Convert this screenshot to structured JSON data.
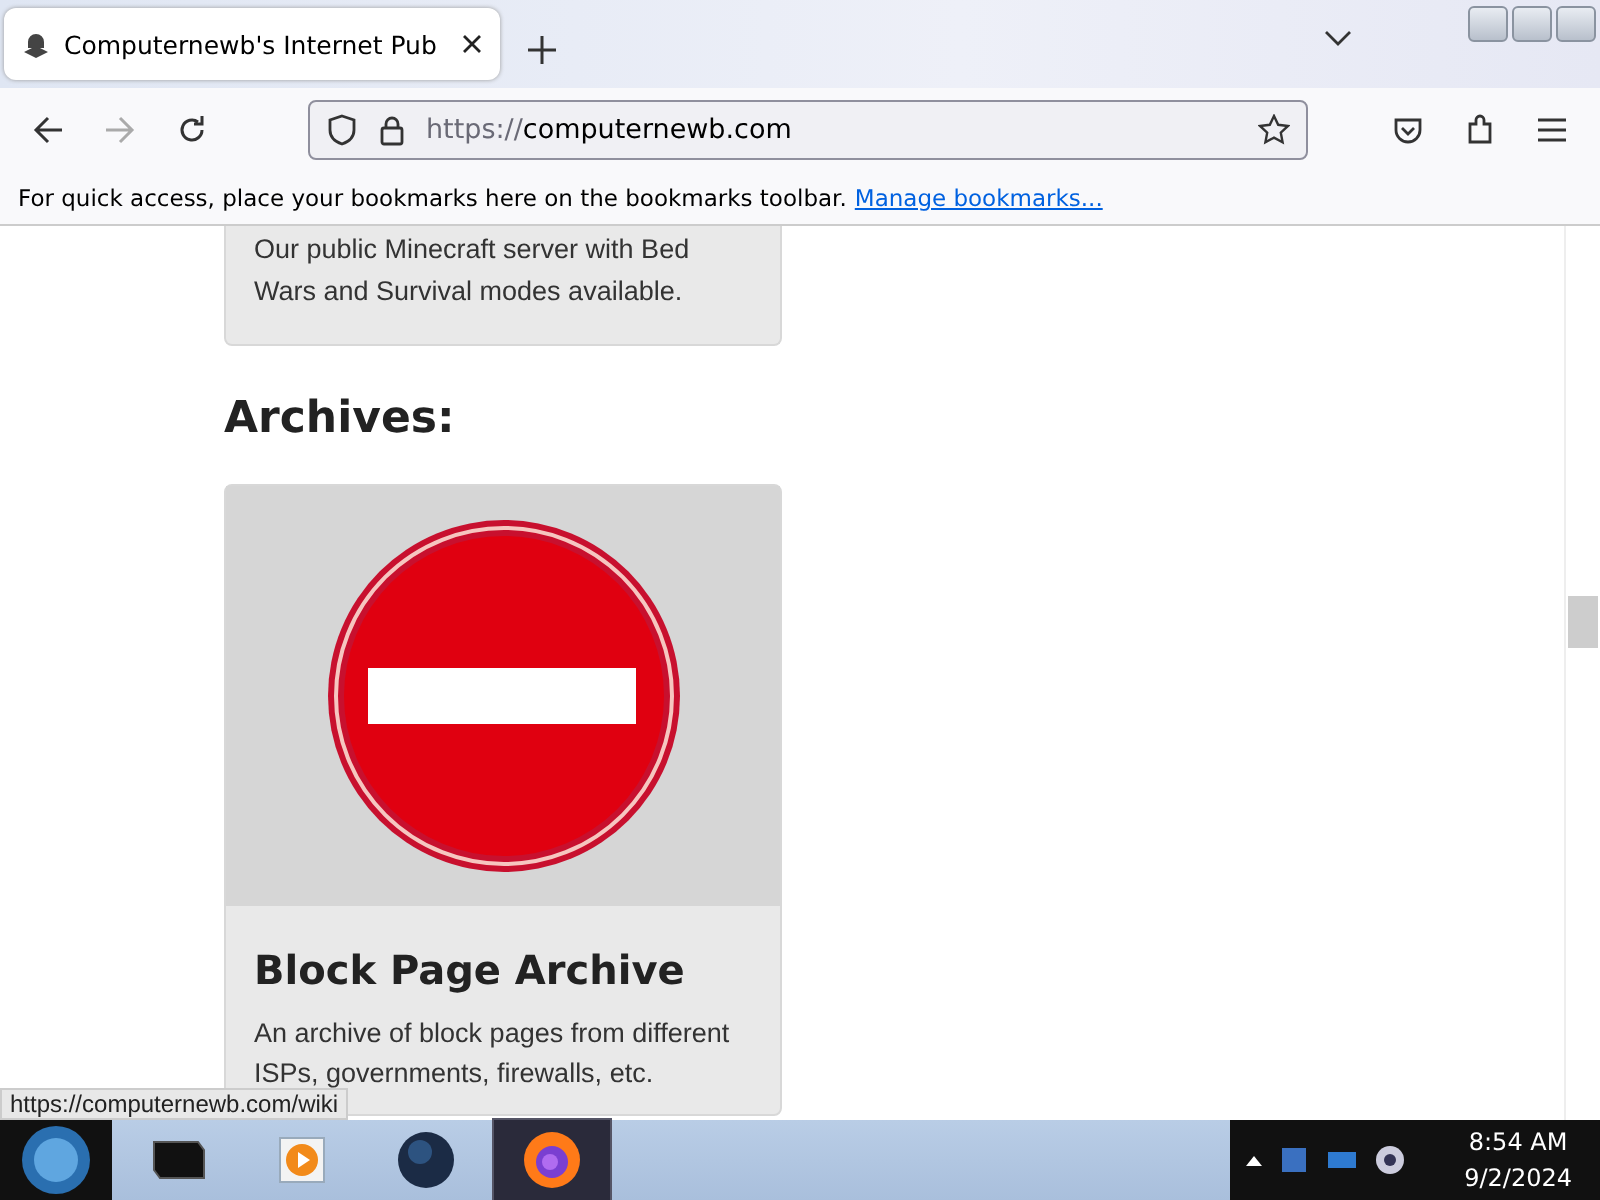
{
  "tabs": [
    {
      "title": "Computernewb's Internet Pub",
      "selected": true
    }
  ],
  "address_bar": {
    "protocol": "https://",
    "host": "computernewb.com"
  },
  "bookmarks_bar": {
    "message": "For quick access, place your bookmarks here on the bookmarks toolbar.",
    "link": "Manage bookmarks..."
  },
  "page": {
    "cards_before": [
      {
        "description": "Our public Minecraft server with Bed Wars and Survival modes available."
      }
    ],
    "heading": "Archives:",
    "cards": [
      {
        "title": "Block Page Archive",
        "description": "An archive of block pages from different ISPs, governments, firewalls, etc."
      }
    ]
  },
  "status_link": "https://computernewb.com/wiki",
  "taskbar": {
    "apps": [
      {
        "kind": "terminal",
        "selected": false
      },
      {
        "kind": "media",
        "selected": false
      },
      {
        "kind": "globe",
        "selected": false
      },
      {
        "kind": "firefox",
        "selected": true
      }
    ],
    "time": "8:54 AM",
    "date": "9/2/2024"
  }
}
